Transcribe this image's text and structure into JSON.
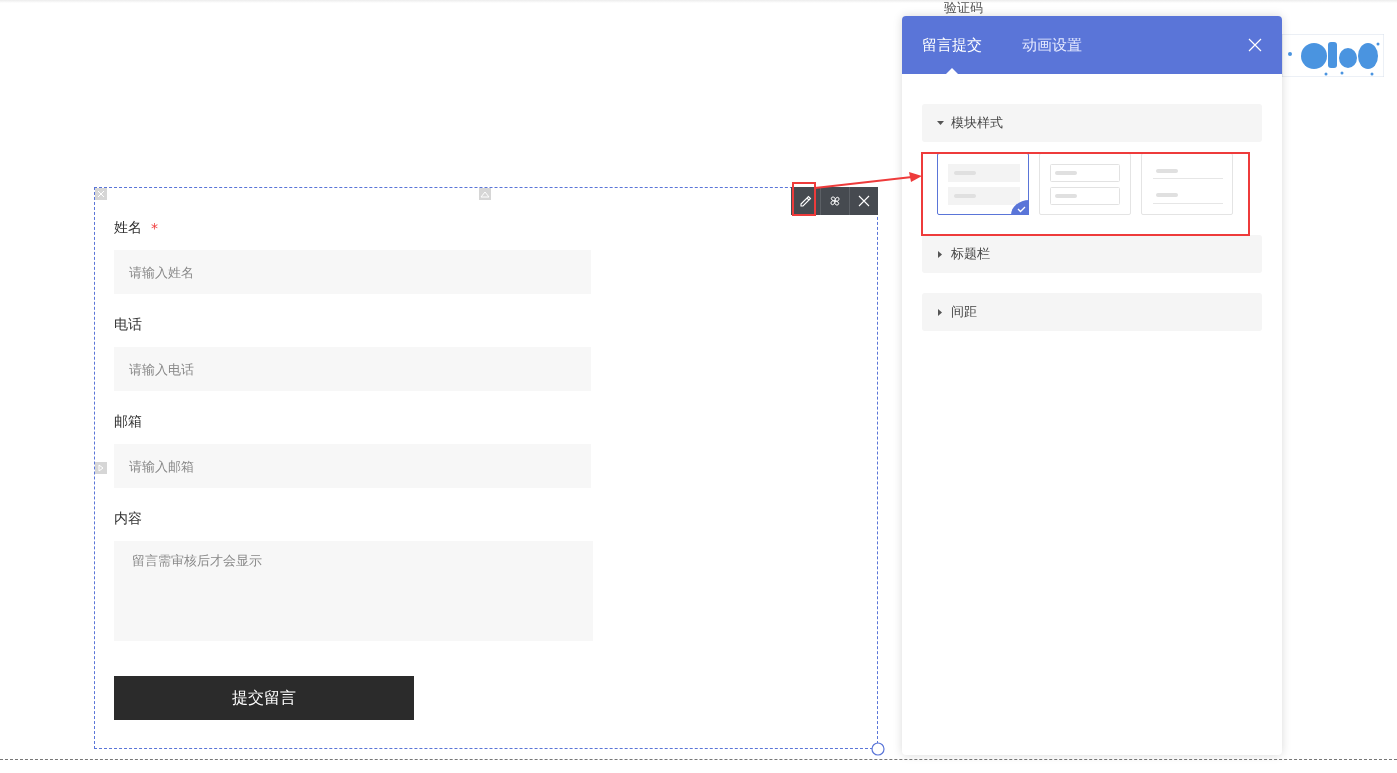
{
  "captcha": {
    "label": "验证码"
  },
  "form": {
    "fields": [
      {
        "label": "姓名",
        "required_mark": "*",
        "placeholder": "请输入姓名",
        "kind": "input"
      },
      {
        "label": "电话",
        "placeholder": "请输入电话",
        "kind": "input"
      },
      {
        "label": "邮箱",
        "placeholder": "请输入邮箱",
        "kind": "input"
      },
      {
        "label": "内容",
        "placeholder": "留言需审核后才会显示",
        "kind": "textarea"
      }
    ],
    "submit": "提交留言"
  },
  "panel": {
    "tabs": [
      {
        "label": "留言提交",
        "selected": true
      },
      {
        "label": "动画设置",
        "selected": false
      }
    ],
    "sections": [
      {
        "title": "模块样式",
        "expanded": true,
        "styles": [
          {
            "kind": "filled",
            "selected": true
          },
          {
            "kind": "outlined",
            "selected": false
          },
          {
            "kind": "underlined",
            "selected": false
          }
        ]
      },
      {
        "title": "标题栏",
        "expanded": false
      },
      {
        "title": "间距",
        "expanded": false
      }
    ]
  }
}
